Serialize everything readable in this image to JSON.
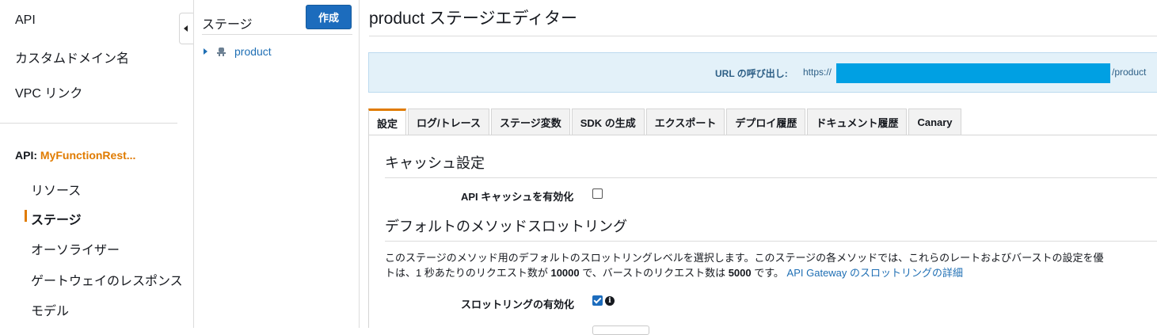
{
  "leftnav": {
    "top_items": [
      "API",
      "カスタムドメイン名",
      "VPC リンク"
    ],
    "api_prefix": "API: ",
    "api_name": "MyFunctionRest...",
    "sub_items": [
      "リソース",
      "ステージ",
      "オーソライザー",
      "ゲートウェイのレスポンス",
      "モデル"
    ]
  },
  "tree": {
    "title": "ステージ",
    "create_label": "作成",
    "items": [
      {
        "label": "product"
      }
    ]
  },
  "main": {
    "title": "product ステージエディター",
    "invoke": {
      "label": "URL の呼び出し:",
      "prefix": "https://",
      "suffix": "/product"
    },
    "tabs": [
      "設定",
      "ログ/トレース",
      "ステージ変数",
      "SDK の生成",
      "エクスポート",
      "デプロイ履歴",
      "ドキュメント履歴",
      "Canary"
    ],
    "cache": {
      "heading": "キャッシュ設定",
      "enable_label": "API キャッシュを有効化",
      "enabled": false
    },
    "throttle": {
      "heading": "デフォルトのメソッドスロットリング",
      "desc_line1": "このステージのメソッド用のデフォルトのスロットリングレベルを選択します。このステージの各メソッドでは、これらのレートおよびバーストの設定を優",
      "desc_line2_a": "トは、1 秒あたりのリクエスト数が ",
      "rate": "10000",
      "desc_line2_b": " で、バーストのリクエスト数は ",
      "burst": "5000",
      "desc_line2_c": " です。",
      "link": "API Gateway のスロットリングの詳細",
      "enable_label": "スロットリングの有効化",
      "enabled": true
    }
  },
  "colors": {
    "accent_orange": "#e07b00",
    "link_blue": "#1f6fb4",
    "primary_button": "#1c6cbd",
    "info_bg": "#e3f1f9",
    "redaction": "#00a0e3"
  }
}
